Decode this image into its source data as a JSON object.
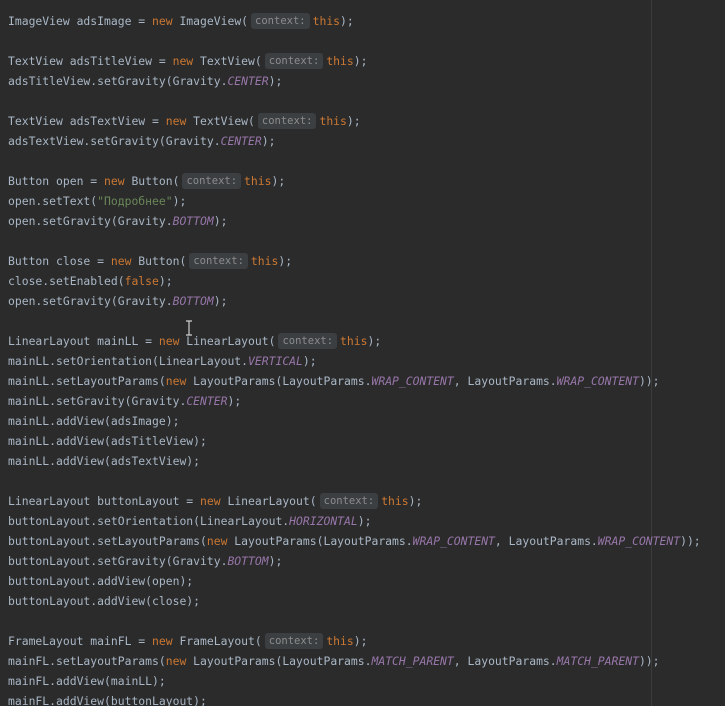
{
  "lines": [
    [
      {
        "t": "ImageView adsImage = "
      },
      {
        "t": "new",
        "k": "kw"
      },
      {
        "t": " ImageView("
      },
      {
        "t": "context:",
        "k": "hint"
      },
      {
        "t": "this",
        "k": "kw"
      },
      {
        "t": ");"
      }
    ],
    [],
    [
      {
        "t": "TextView adsTitleView = "
      },
      {
        "t": "new",
        "k": "kw"
      },
      {
        "t": " TextView("
      },
      {
        "t": "context:",
        "k": "hint"
      },
      {
        "t": "this",
        "k": "kw"
      },
      {
        "t": ");"
      }
    ],
    [
      {
        "t": "adsTitleView.setGravity(Gravity."
      },
      {
        "t": "CENTER",
        "k": "const"
      },
      {
        "t": ");"
      }
    ],
    [],
    [
      {
        "t": "TextView adsTextView = "
      },
      {
        "t": "new",
        "k": "kw"
      },
      {
        "t": " TextView("
      },
      {
        "t": "context:",
        "k": "hint"
      },
      {
        "t": "this",
        "k": "kw"
      },
      {
        "t": ");"
      }
    ],
    [
      {
        "t": "adsTextView.setGravity(Gravity."
      },
      {
        "t": "CENTER",
        "k": "const"
      },
      {
        "t": ");"
      }
    ],
    [],
    [
      {
        "t": "Button open = "
      },
      {
        "t": "new",
        "k": "kw"
      },
      {
        "t": " Button("
      },
      {
        "t": "context:",
        "k": "hint"
      },
      {
        "t": "this",
        "k": "kw"
      },
      {
        "t": ");"
      }
    ],
    [
      {
        "t": "open.setText("
      },
      {
        "t": "\"Подробнее\"",
        "k": "str"
      },
      {
        "t": ");"
      }
    ],
    [
      {
        "t": "open.setGravity(Gravity."
      },
      {
        "t": "BOTTOM",
        "k": "const"
      },
      {
        "t": ");"
      }
    ],
    [],
    [
      {
        "t": "Button close = "
      },
      {
        "t": "new",
        "k": "kw"
      },
      {
        "t": " Button("
      },
      {
        "t": "context:",
        "k": "hint"
      },
      {
        "t": "this",
        "k": "kw"
      },
      {
        "t": ");"
      }
    ],
    [
      {
        "t": "close.setEnabled("
      },
      {
        "t": "false",
        "k": "kw"
      },
      {
        "t": ");"
      }
    ],
    [
      {
        "t": "open.setGravity(Gravity."
      },
      {
        "t": "BOTTOM",
        "k": "const"
      },
      {
        "t": ");"
      }
    ],
    [],
    [
      {
        "t": "LinearLayout mainLL = "
      },
      {
        "t": "new",
        "k": "kw"
      },
      {
        "t": " LinearLayout("
      },
      {
        "t": "context:",
        "k": "hint"
      },
      {
        "t": "this",
        "k": "kw"
      },
      {
        "t": ");"
      }
    ],
    [
      {
        "t": "mainLL.setOrientation(LinearLayout."
      },
      {
        "t": "VERTICAL",
        "k": "const"
      },
      {
        "t": ");"
      }
    ],
    [
      {
        "t": "mainLL.setLayoutParams("
      },
      {
        "t": "new",
        "k": "kw"
      },
      {
        "t": " LayoutParams(LayoutParams."
      },
      {
        "t": "WRAP_CONTENT",
        "k": "const"
      },
      {
        "t": ", LayoutParams."
      },
      {
        "t": "WRAP_CONTENT",
        "k": "const"
      },
      {
        "t": "));"
      }
    ],
    [
      {
        "t": "mainLL.setGravity(Gravity."
      },
      {
        "t": "CENTER",
        "k": "const"
      },
      {
        "t": ");"
      }
    ],
    [
      {
        "t": "mainLL.addView(adsImage);"
      }
    ],
    [
      {
        "t": "mainLL.addView(adsTitleView);"
      }
    ],
    [
      {
        "t": "mainLL.addView(adsTextView);"
      }
    ],
    [],
    [
      {
        "t": "LinearLayout buttonLayout = "
      },
      {
        "t": "new",
        "k": "kw"
      },
      {
        "t": " LinearLayout("
      },
      {
        "t": "context:",
        "k": "hint"
      },
      {
        "t": "this",
        "k": "kw"
      },
      {
        "t": ");"
      }
    ],
    [
      {
        "t": "buttonLayout.setOrientation(LinearLayout."
      },
      {
        "t": "HORIZONTAL",
        "k": "const"
      },
      {
        "t": ");"
      }
    ],
    [
      {
        "t": "buttonLayout.setLayoutParams("
      },
      {
        "t": "new",
        "k": "kw"
      },
      {
        "t": " LayoutParams(LayoutParams."
      },
      {
        "t": "WRAP_CONTENT",
        "k": "const"
      },
      {
        "t": ", LayoutParams."
      },
      {
        "t": "WRAP_CONTENT",
        "k": "const"
      },
      {
        "t": "));"
      }
    ],
    [
      {
        "t": "buttonLayout.setGravity(Gravity."
      },
      {
        "t": "BOTTOM",
        "k": "const"
      },
      {
        "t": ");"
      }
    ],
    [
      {
        "t": "buttonLayout.addView(open);"
      }
    ],
    [
      {
        "t": "buttonLayout.addView(close);"
      }
    ],
    [],
    [
      {
        "t": "FrameLayout mainFL = "
      },
      {
        "t": "new",
        "k": "kw"
      },
      {
        "t": " FrameLayout("
      },
      {
        "t": "context:",
        "k": "hint"
      },
      {
        "t": "this",
        "k": "kw"
      },
      {
        "t": ");"
      }
    ],
    [
      {
        "t": "mainFL.setLayoutParams("
      },
      {
        "t": "new",
        "k": "kw"
      },
      {
        "t": " LayoutParams(LayoutParams."
      },
      {
        "t": "MATCH_PARENT",
        "k": "const"
      },
      {
        "t": ", LayoutParams."
      },
      {
        "t": "MATCH_PARENT",
        "k": "const"
      },
      {
        "t": "));"
      }
    ],
    [
      {
        "t": "mainFL.addView(mainLL);"
      }
    ],
    [
      {
        "t": "mainFL.addView(buttonLayout);"
      }
    ]
  ],
  "colors": {
    "background": "#2b2b2b",
    "text": "#a9b7c6",
    "keyword": "#cc7832",
    "string": "#6a8759",
    "constant": "#9876aa",
    "hint_bg": "#3b3f41",
    "hint_text": "#8c8c8c"
  },
  "cursor_icon": "text-cursor-icon"
}
